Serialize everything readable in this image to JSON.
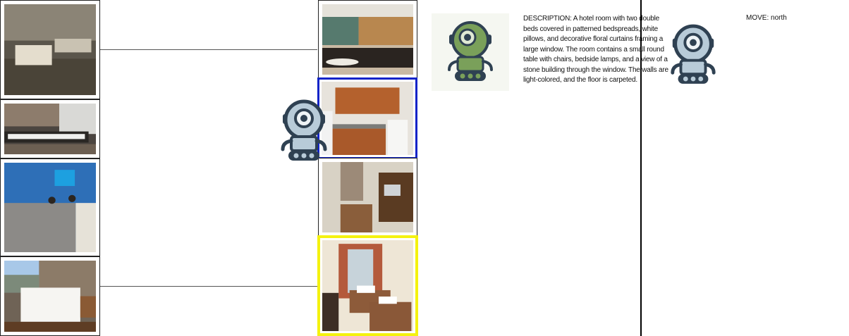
{
  "left_column": {
    "images": [
      {
        "alt": "basement room with old beds"
      },
      {
        "alt": "synthesizer keyboard studio"
      },
      {
        "alt": "blue reception desk with staff"
      },
      {
        "alt": "bright hotel bedroom with white bed"
      }
    ]
  },
  "middle_column": {
    "images": [
      {
        "alt": "hotel lobby lounge"
      },
      {
        "alt": "kitchen with wooden cabinets",
        "highlight": "blue"
      },
      {
        "alt": "room with desk and tv"
      },
      {
        "alt": "hotel room with two double beds",
        "highlight": "yellow"
      }
    ]
  },
  "agent_icons": {
    "map_robot": "robot-icon",
    "guide_robot": "green-robot-icon",
    "player_robot": "robot-icon"
  },
  "panel": {
    "description": "DESCRIPTION: A hotel room with two double beds covered in patterned bedspreads, white pillows, and decorative floral curtains framing a large window. The room contains a small round table with chairs, bedside lamps, and a view of a stone building through the window. The walls are light-colored, and the floor is carpeted.",
    "move": "MOVE: north"
  },
  "colors": {
    "current_highlight": "#1023c8",
    "target_highlight": "#f4f20f",
    "robot_body": "#b8cbd8",
    "robot_outline": "#2f4152",
    "green_robot": "#7aa05a"
  }
}
